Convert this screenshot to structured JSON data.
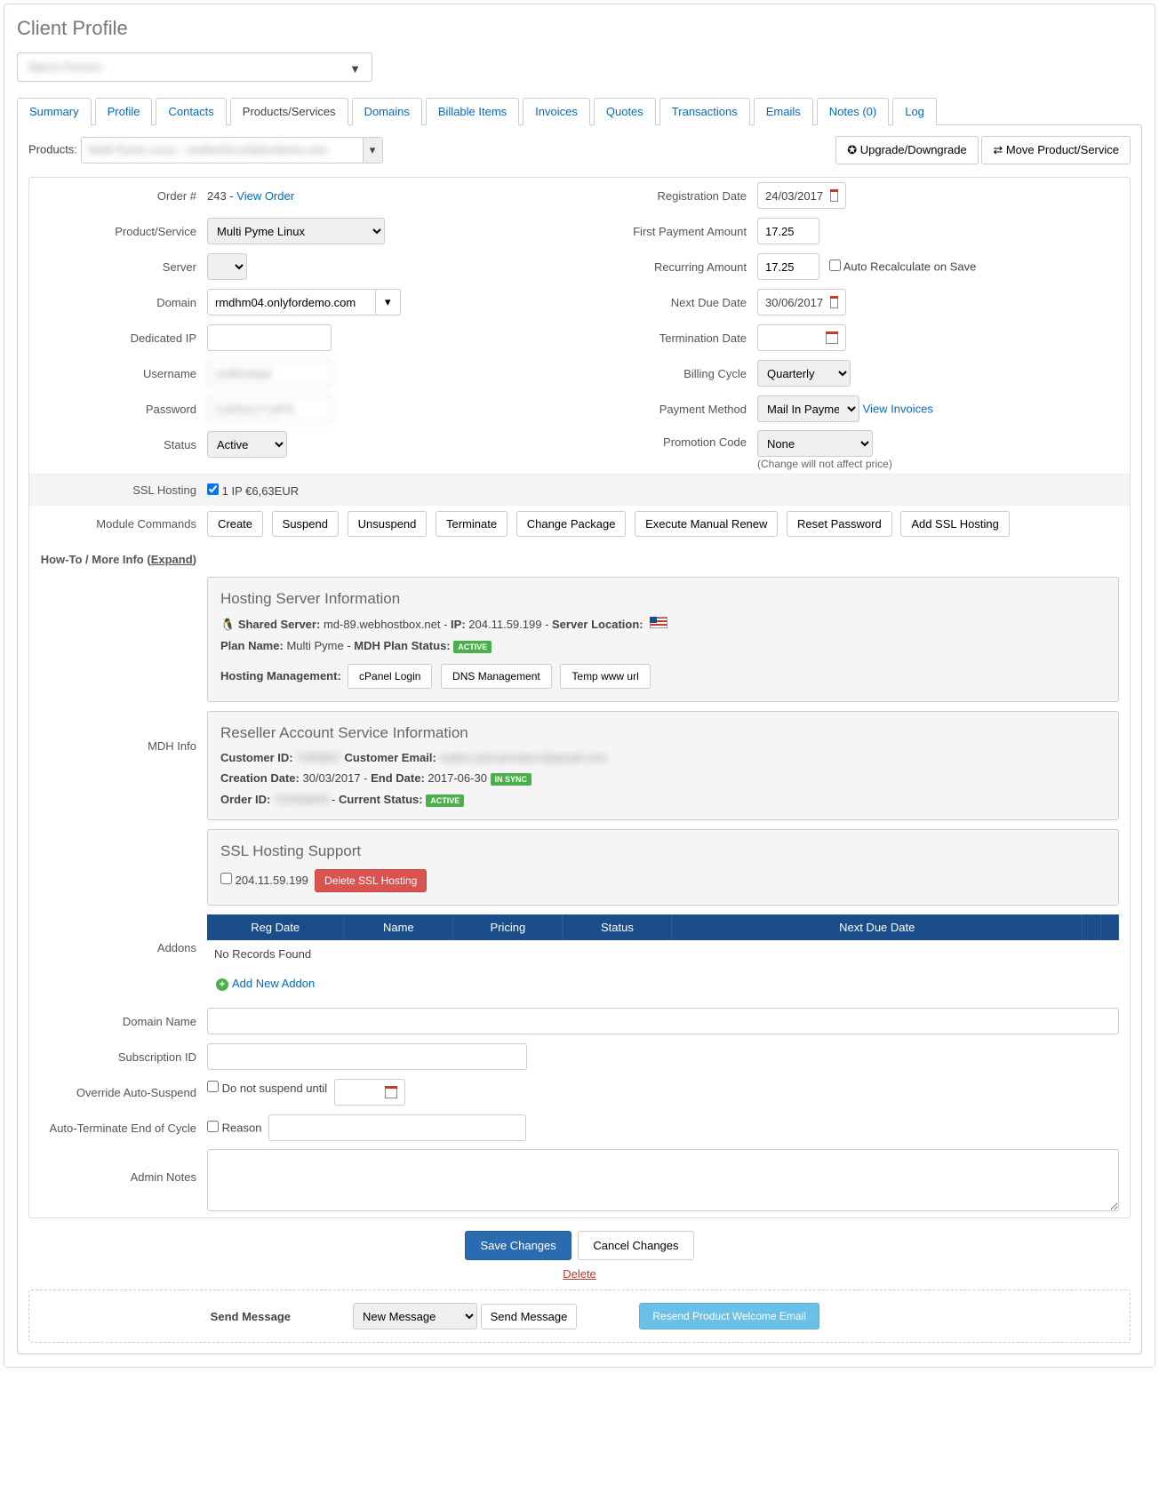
{
  "page_title": "Client Profile",
  "client_name": "Marco Ferrero",
  "tabs": [
    "Summary",
    "Profile",
    "Contacts",
    "Products/Services",
    "Domains",
    "Billable Items",
    "Invoices",
    "Quotes",
    "Transactions",
    "Emails",
    "Notes (0)",
    "Log"
  ],
  "active_tab": "Products/Services",
  "products_label": "Products:",
  "products_selected": "Multi Pyme Linux - rmdhm04.onlyfordemo.com",
  "upgrade_btn": "Upgrade/Downgrade",
  "move_btn": "Move Product/Service",
  "left": {
    "order_label": "Order #",
    "order_id": "243",
    "view_order": "View Order",
    "product_service_label": "Product/Service",
    "product_service": "Multi Pyme Linux",
    "server_label": "Server",
    "domain_label": "Domain",
    "domain": "rmdhm04.onlyfordemo.com",
    "dedicated_ip_label": "Dedicated IP",
    "username_label": "Username",
    "username": "rmdhmkaw",
    "password_label": "Password",
    "password": "Ca05uL2*14f*9",
    "status_label": "Status",
    "status": "Active"
  },
  "right": {
    "reg_date_label": "Registration Date",
    "reg_date": "24/03/2017",
    "first_payment_label": "First Payment Amount",
    "first_payment": "17.25",
    "recurring_label": "Recurring Amount",
    "recurring": "17.25",
    "auto_recalc": "Auto Recalculate on Save",
    "next_due_label": "Next Due Date",
    "next_due": "30/06/2017",
    "termination_label": "Termination Date",
    "billing_cycle_label": "Billing Cycle",
    "billing_cycle": "Quarterly",
    "payment_method_label": "Payment Method",
    "payment_method": "Mail In Payment",
    "view_invoices": "View Invoices",
    "promo_label": "Promotion Code",
    "promo": "None",
    "promo_note": "(Change will not affect price)"
  },
  "ssl_hosting_label": "SSL Hosting",
  "ssl_hosting_text": "1 IP €6,63EUR",
  "module_commands_label": "Module Commands",
  "module_commands": [
    "Create",
    "Suspend",
    "Unsuspend",
    "Terminate",
    "Change Package",
    "Execute Manual Renew",
    "Reset Password",
    "Add SSL Hosting"
  ],
  "howto_label": "How-To / More Info (",
  "howto_expand": "Expand",
  "howto_close": ")",
  "mdh_info_label": "MDH Info",
  "hosting": {
    "title": "Hosting Server Information",
    "shared_server_lbl": "Shared Server:",
    "shared_server": "md-89.webhostbox.net",
    "ip_lbl": "IP:",
    "ip": "204.11.59.199",
    "location_lbl": "Server Location:",
    "plan_name_lbl": "Plan Name:",
    "plan_name": "Multi Pyme",
    "plan_status_lbl": "MDH Plan Status:",
    "plan_status": "ACTIVE",
    "mgmt_lbl": "Hosting Management:",
    "mgmt_btns": [
      "cPanel Login",
      "DNS Management",
      "Temp www url"
    ]
  },
  "reseller": {
    "title": "Reseller Account Service Information",
    "customer_id_lbl": "Customer ID:",
    "customer_id": "7080867",
    "customer_email_lbl": "Customer Email:",
    "customer_email": "mafeo.astroamateur@gmail.com",
    "creation_lbl": "Creation Date:",
    "creation": "30/03/2017",
    "end_lbl": "End Date:",
    "end": "2017-06-30",
    "sync": "IN SYNC",
    "order_id_lbl": "Order ID:",
    "order_id": "75/936839",
    "status_lbl": "Current Status:",
    "status": "ACTIVE"
  },
  "ssl_support": {
    "title": "SSL Hosting Support",
    "ip": "204.11.59.199",
    "delete_btn": "Delete SSL Hosting"
  },
  "addons_label": "Addons",
  "addon_headers": [
    "Reg Date",
    "Name",
    "Pricing",
    "Status",
    "Next Due Date"
  ],
  "no_records": "No Records Found",
  "add_addon": "Add New Addon",
  "domain_name_label": "Domain Name",
  "subscription_label": "Subscription ID",
  "override_label": "Override Auto-Suspend",
  "override_text": "Do not suspend until",
  "auto_term_label": "Auto-Terminate End of Cycle",
  "reason_text": "Reason",
  "admin_notes_label": "Admin Notes",
  "save_btn": "Save Changes",
  "cancel_btn": "Cancel Changes",
  "delete_link": "Delete",
  "send_message_label": "Send Message",
  "new_message": "New Message",
  "send_message_btn": "Send Message",
  "resend_btn": "Resend Product Welcome Email"
}
